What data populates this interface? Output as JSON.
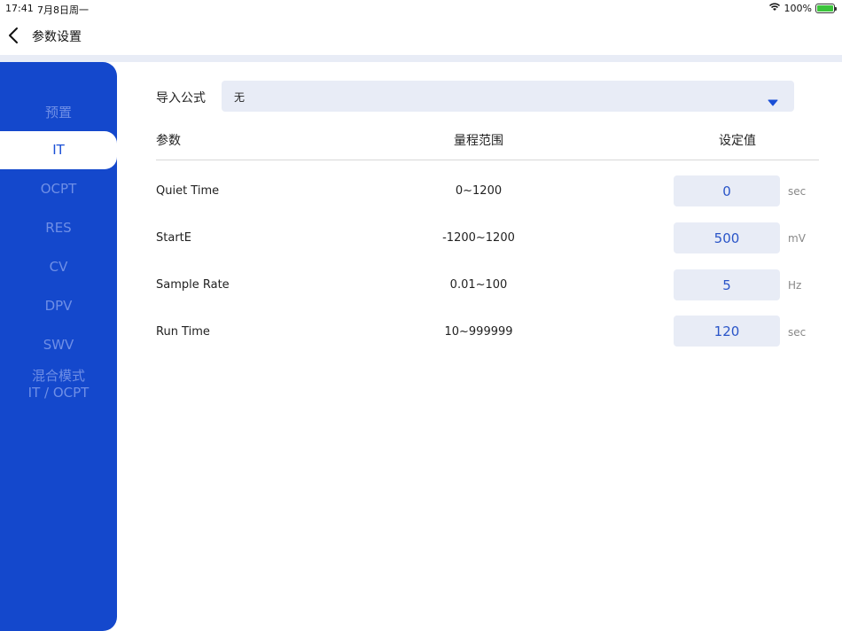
{
  "status": {
    "time": "17:41",
    "date": "7月8日周一",
    "battery": "100%"
  },
  "nav": {
    "title": "参数设置"
  },
  "sidebar": {
    "items": [
      {
        "label": "预置"
      },
      {
        "label": "IT"
      },
      {
        "label": "OCPT"
      },
      {
        "label": "RES"
      },
      {
        "label": "CV"
      },
      {
        "label": "DPV"
      },
      {
        "label": "SWV"
      },
      {
        "label": "混合模式",
        "label2": "IT / OCPT"
      }
    ],
    "active": "IT"
  },
  "import": {
    "label": "导入公式",
    "value": "无"
  },
  "table": {
    "headers": {
      "param": "参数",
      "range": "量程范围",
      "value": "设定值"
    },
    "rows": [
      {
        "name": "Quiet Time",
        "range": "0~1200",
        "value": "0",
        "unit": "sec"
      },
      {
        "name": "StartE",
        "range": "-1200~1200",
        "value": "500",
        "unit": "mV"
      },
      {
        "name": "Sample Rate",
        "range": "0.01~100",
        "value": "5",
        "unit": "Hz"
      },
      {
        "name": "Run Time",
        "range": "10~999999",
        "value": "120",
        "unit": "sec"
      }
    ]
  },
  "colors": {
    "accent": "#1448cc",
    "field_bg": "#e8ecf6",
    "value_text": "#2a55c8"
  }
}
